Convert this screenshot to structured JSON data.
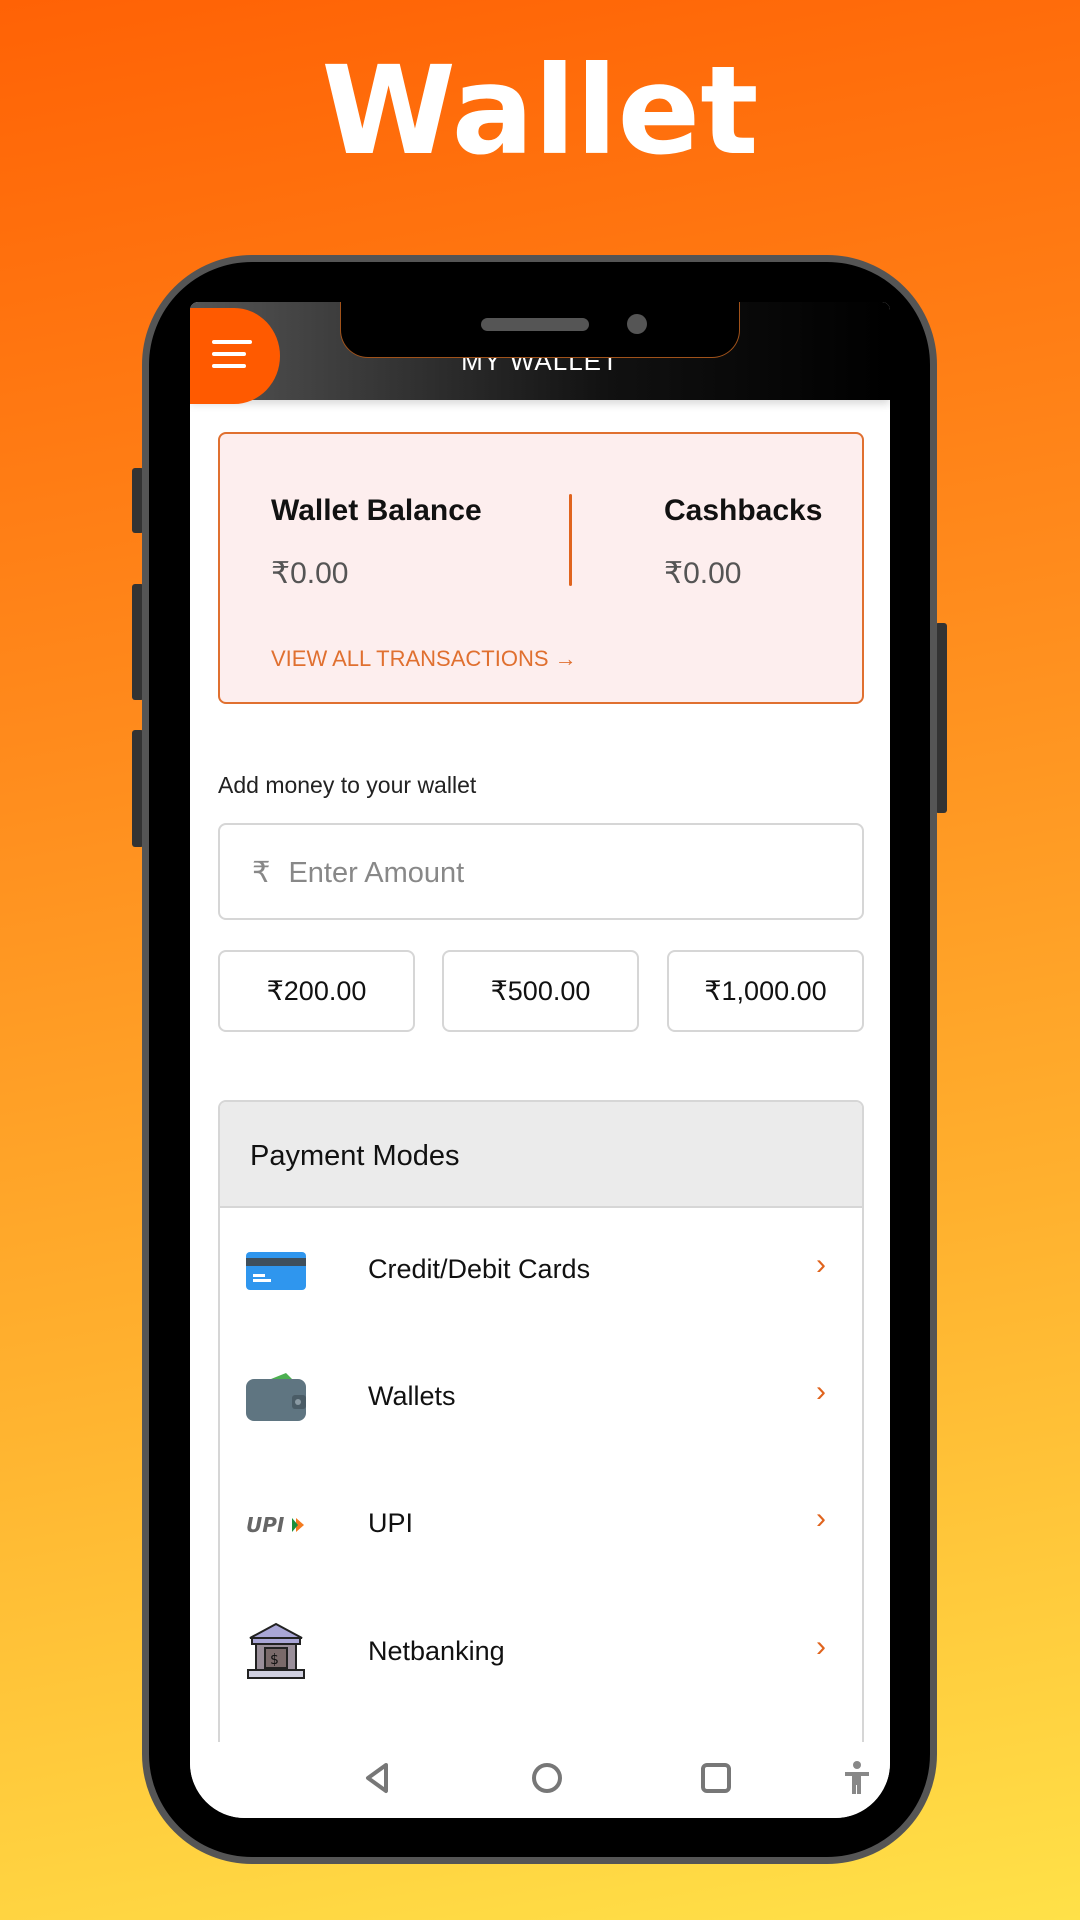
{
  "banner_title": "Wallet",
  "header": {
    "title": "MY WALLET",
    "menu_icon": "hamburger-icon"
  },
  "balance_card": {
    "wallet_balance_label": "Wallet Balance",
    "wallet_balance_value": "₹0.00",
    "cashbacks_label": "Cashbacks",
    "cashbacks_value": "₹0.00",
    "view_all": "VIEW ALL TRANSACTIONS →"
  },
  "add_money": {
    "label": "Add money to your wallet",
    "currency_symbol": "₹",
    "placeholder": "Enter Amount",
    "value": "",
    "presets": [
      "₹200.00",
      "₹500.00",
      "₹1,000.00"
    ]
  },
  "payment_modes": {
    "title": "Payment Modes",
    "items": [
      {
        "label": "Credit/Debit Cards",
        "icon": "credit-card-icon"
      },
      {
        "label": "Wallets",
        "icon": "wallet-icon"
      },
      {
        "label": "UPI",
        "icon": "upi-logo-icon"
      },
      {
        "label": "Netbanking",
        "icon": "bank-icon"
      }
    ]
  },
  "colors": {
    "accent": "#e0641e",
    "menu": "#ff5a00",
    "card_bg": "#fdeeee"
  }
}
